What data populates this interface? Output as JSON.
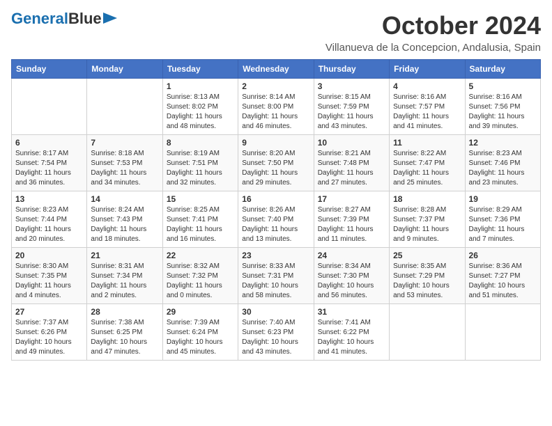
{
  "logo": {
    "part1": "General",
    "part2": "Blue"
  },
  "title": "October 2024",
  "subtitle": "Villanueva de la Concepcion, Andalusia, Spain",
  "days_of_week": [
    "Sunday",
    "Monday",
    "Tuesday",
    "Wednesday",
    "Thursday",
    "Friday",
    "Saturday"
  ],
  "weeks": [
    [
      {
        "day": "",
        "info": ""
      },
      {
        "day": "",
        "info": ""
      },
      {
        "day": "1",
        "info": "Sunrise: 8:13 AM\nSunset: 8:02 PM\nDaylight: 11 hours and 48 minutes."
      },
      {
        "day": "2",
        "info": "Sunrise: 8:14 AM\nSunset: 8:00 PM\nDaylight: 11 hours and 46 minutes."
      },
      {
        "day": "3",
        "info": "Sunrise: 8:15 AM\nSunset: 7:59 PM\nDaylight: 11 hours and 43 minutes."
      },
      {
        "day": "4",
        "info": "Sunrise: 8:16 AM\nSunset: 7:57 PM\nDaylight: 11 hours and 41 minutes."
      },
      {
        "day": "5",
        "info": "Sunrise: 8:16 AM\nSunset: 7:56 PM\nDaylight: 11 hours and 39 minutes."
      }
    ],
    [
      {
        "day": "6",
        "info": "Sunrise: 8:17 AM\nSunset: 7:54 PM\nDaylight: 11 hours and 36 minutes."
      },
      {
        "day": "7",
        "info": "Sunrise: 8:18 AM\nSunset: 7:53 PM\nDaylight: 11 hours and 34 minutes."
      },
      {
        "day": "8",
        "info": "Sunrise: 8:19 AM\nSunset: 7:51 PM\nDaylight: 11 hours and 32 minutes."
      },
      {
        "day": "9",
        "info": "Sunrise: 8:20 AM\nSunset: 7:50 PM\nDaylight: 11 hours and 29 minutes."
      },
      {
        "day": "10",
        "info": "Sunrise: 8:21 AM\nSunset: 7:48 PM\nDaylight: 11 hours and 27 minutes."
      },
      {
        "day": "11",
        "info": "Sunrise: 8:22 AM\nSunset: 7:47 PM\nDaylight: 11 hours and 25 minutes."
      },
      {
        "day": "12",
        "info": "Sunrise: 8:23 AM\nSunset: 7:46 PM\nDaylight: 11 hours and 23 minutes."
      }
    ],
    [
      {
        "day": "13",
        "info": "Sunrise: 8:23 AM\nSunset: 7:44 PM\nDaylight: 11 hours and 20 minutes."
      },
      {
        "day": "14",
        "info": "Sunrise: 8:24 AM\nSunset: 7:43 PM\nDaylight: 11 hours and 18 minutes."
      },
      {
        "day": "15",
        "info": "Sunrise: 8:25 AM\nSunset: 7:41 PM\nDaylight: 11 hours and 16 minutes."
      },
      {
        "day": "16",
        "info": "Sunrise: 8:26 AM\nSunset: 7:40 PM\nDaylight: 11 hours and 13 minutes."
      },
      {
        "day": "17",
        "info": "Sunrise: 8:27 AM\nSunset: 7:39 PM\nDaylight: 11 hours and 11 minutes."
      },
      {
        "day": "18",
        "info": "Sunrise: 8:28 AM\nSunset: 7:37 PM\nDaylight: 11 hours and 9 minutes."
      },
      {
        "day": "19",
        "info": "Sunrise: 8:29 AM\nSunset: 7:36 PM\nDaylight: 11 hours and 7 minutes."
      }
    ],
    [
      {
        "day": "20",
        "info": "Sunrise: 8:30 AM\nSunset: 7:35 PM\nDaylight: 11 hours and 4 minutes."
      },
      {
        "day": "21",
        "info": "Sunrise: 8:31 AM\nSunset: 7:34 PM\nDaylight: 11 hours and 2 minutes."
      },
      {
        "day": "22",
        "info": "Sunrise: 8:32 AM\nSunset: 7:32 PM\nDaylight: 11 hours and 0 minutes."
      },
      {
        "day": "23",
        "info": "Sunrise: 8:33 AM\nSunset: 7:31 PM\nDaylight: 10 hours and 58 minutes."
      },
      {
        "day": "24",
        "info": "Sunrise: 8:34 AM\nSunset: 7:30 PM\nDaylight: 10 hours and 56 minutes."
      },
      {
        "day": "25",
        "info": "Sunrise: 8:35 AM\nSunset: 7:29 PM\nDaylight: 10 hours and 53 minutes."
      },
      {
        "day": "26",
        "info": "Sunrise: 8:36 AM\nSunset: 7:27 PM\nDaylight: 10 hours and 51 minutes."
      }
    ],
    [
      {
        "day": "27",
        "info": "Sunrise: 7:37 AM\nSunset: 6:26 PM\nDaylight: 10 hours and 49 minutes."
      },
      {
        "day": "28",
        "info": "Sunrise: 7:38 AM\nSunset: 6:25 PM\nDaylight: 10 hours and 47 minutes."
      },
      {
        "day": "29",
        "info": "Sunrise: 7:39 AM\nSunset: 6:24 PM\nDaylight: 10 hours and 45 minutes."
      },
      {
        "day": "30",
        "info": "Sunrise: 7:40 AM\nSunset: 6:23 PM\nDaylight: 10 hours and 43 minutes."
      },
      {
        "day": "31",
        "info": "Sunrise: 7:41 AM\nSunset: 6:22 PM\nDaylight: 10 hours and 41 minutes."
      },
      {
        "day": "",
        "info": ""
      },
      {
        "day": "",
        "info": ""
      }
    ]
  ]
}
